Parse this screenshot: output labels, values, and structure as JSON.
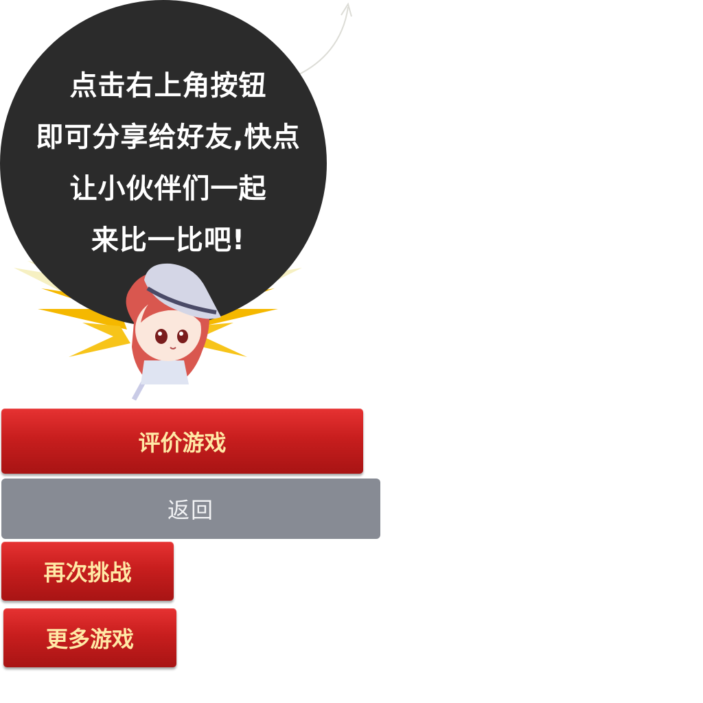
{
  "share_prompt": {
    "lines": [
      "点击右上角按钮",
      "即可分享给好友,快点",
      "让小伙伴们一起",
      "来比一比吧!"
    ]
  },
  "buttons": {
    "rate": "评价游戏",
    "back": "返回",
    "retry": "再次挑战",
    "more": "更多游戏"
  },
  "colors": {
    "bubble": "#2b2b2b",
    "button_red": "#c81e1e",
    "button_gray": "#878b94",
    "button_red_text": "#ffe9a6"
  }
}
